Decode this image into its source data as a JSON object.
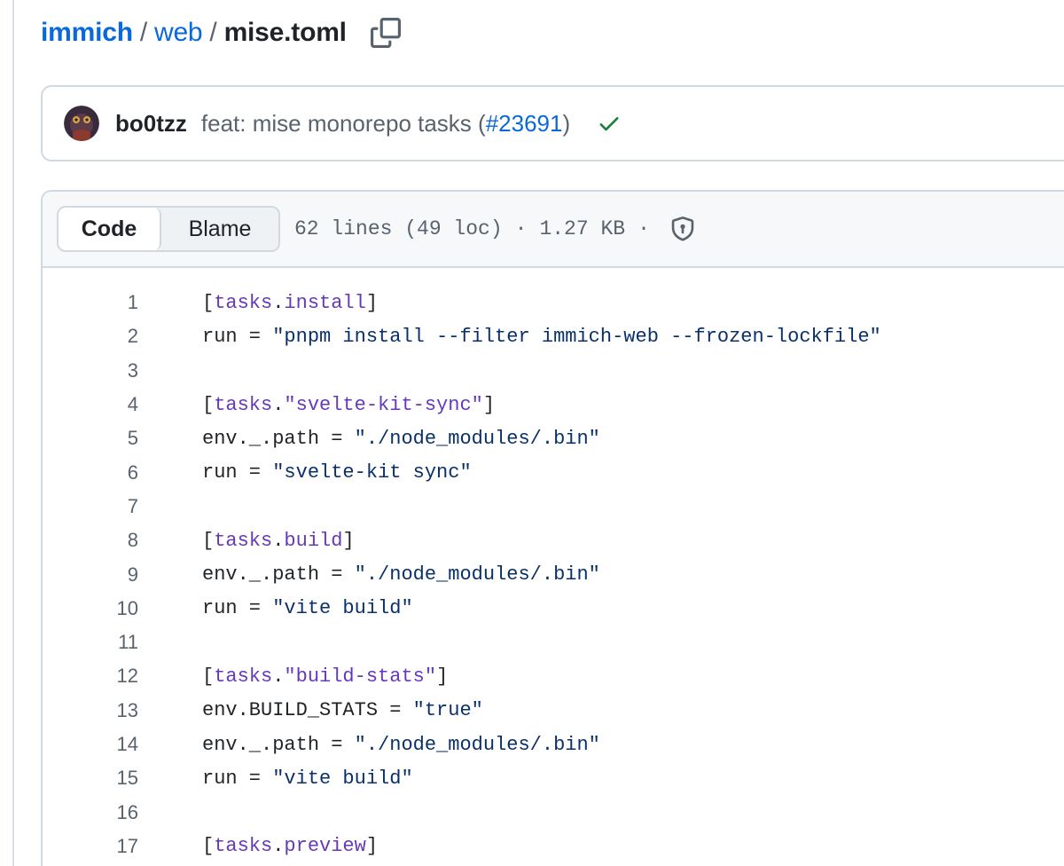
{
  "breadcrumb": {
    "repo": "immich",
    "sep1": "/",
    "folder": "web",
    "sep2": "/",
    "file": "mise.toml"
  },
  "commit": {
    "author": "bo0tzz",
    "message": "feat: mise monorepo tasks (",
    "pr": "#23691",
    "message_end": ")",
    "status_icon": "check-icon",
    "status_color": "#1a7f37"
  },
  "file_header": {
    "code_label": "Code",
    "blame_label": "Blame",
    "lines_info": "62 lines (49 loc)",
    "dot": "·",
    "size": "1.27 KB",
    "dot2": "·",
    "security_icon": "shield-icon"
  },
  "colors": {
    "link": "#0969da",
    "toml_key": "#6639ba",
    "toml_string": "#0a3069"
  },
  "lines": [
    {
      "n": "1",
      "tokens": [
        {
          "t": "[",
          "c": "plain"
        },
        {
          "t": "tasks",
          "c": "key"
        },
        {
          "t": ".",
          "c": "plain"
        },
        {
          "t": "install",
          "c": "key"
        },
        {
          "t": "]",
          "c": "plain"
        }
      ]
    },
    {
      "n": "2",
      "tokens": [
        {
          "t": "run = ",
          "c": "plain"
        },
        {
          "t": "\"pnpm install --filter immich-web --frozen-lockfile\"",
          "c": "str"
        }
      ]
    },
    {
      "n": "3",
      "tokens": []
    },
    {
      "n": "4",
      "tokens": [
        {
          "t": "[",
          "c": "plain"
        },
        {
          "t": "tasks",
          "c": "key"
        },
        {
          "t": ".",
          "c": "plain"
        },
        {
          "t": "\"svelte-kit-sync\"",
          "c": "key"
        },
        {
          "t": "]",
          "c": "plain"
        }
      ]
    },
    {
      "n": "5",
      "tokens": [
        {
          "t": "env._.path = ",
          "c": "plain"
        },
        {
          "t": "\"./node_modules/.bin\"",
          "c": "str"
        }
      ]
    },
    {
      "n": "6",
      "tokens": [
        {
          "t": "run = ",
          "c": "plain"
        },
        {
          "t": "\"svelte-kit sync\"",
          "c": "str"
        }
      ]
    },
    {
      "n": "7",
      "tokens": []
    },
    {
      "n": "8",
      "tokens": [
        {
          "t": "[",
          "c": "plain"
        },
        {
          "t": "tasks",
          "c": "key"
        },
        {
          "t": ".",
          "c": "plain"
        },
        {
          "t": "build",
          "c": "key"
        },
        {
          "t": "]",
          "c": "plain"
        }
      ]
    },
    {
      "n": "9",
      "tokens": [
        {
          "t": "env._.path = ",
          "c": "plain"
        },
        {
          "t": "\"./node_modules/.bin\"",
          "c": "str"
        }
      ]
    },
    {
      "n": "10",
      "tokens": [
        {
          "t": "run = ",
          "c": "plain"
        },
        {
          "t": "\"vite build\"",
          "c": "str"
        }
      ]
    },
    {
      "n": "11",
      "tokens": []
    },
    {
      "n": "12",
      "tokens": [
        {
          "t": "[",
          "c": "plain"
        },
        {
          "t": "tasks",
          "c": "key"
        },
        {
          "t": ".",
          "c": "plain"
        },
        {
          "t": "\"build-stats\"",
          "c": "key"
        },
        {
          "t": "]",
          "c": "plain"
        }
      ]
    },
    {
      "n": "13",
      "tokens": [
        {
          "t": "env.BUILD_STATS = ",
          "c": "plain"
        },
        {
          "t": "\"true\"",
          "c": "str"
        }
      ]
    },
    {
      "n": "14",
      "tokens": [
        {
          "t": "env._.path = ",
          "c": "plain"
        },
        {
          "t": "\"./node_modules/.bin\"",
          "c": "str"
        }
      ]
    },
    {
      "n": "15",
      "tokens": [
        {
          "t": "run = ",
          "c": "plain"
        },
        {
          "t": "\"vite build\"",
          "c": "str"
        }
      ]
    },
    {
      "n": "16",
      "tokens": []
    },
    {
      "n": "17",
      "tokens": [
        {
          "t": "[",
          "c": "plain"
        },
        {
          "t": "tasks",
          "c": "key"
        },
        {
          "t": ".",
          "c": "plain"
        },
        {
          "t": "preview",
          "c": "key"
        },
        {
          "t": "]",
          "c": "plain"
        }
      ]
    }
  ]
}
